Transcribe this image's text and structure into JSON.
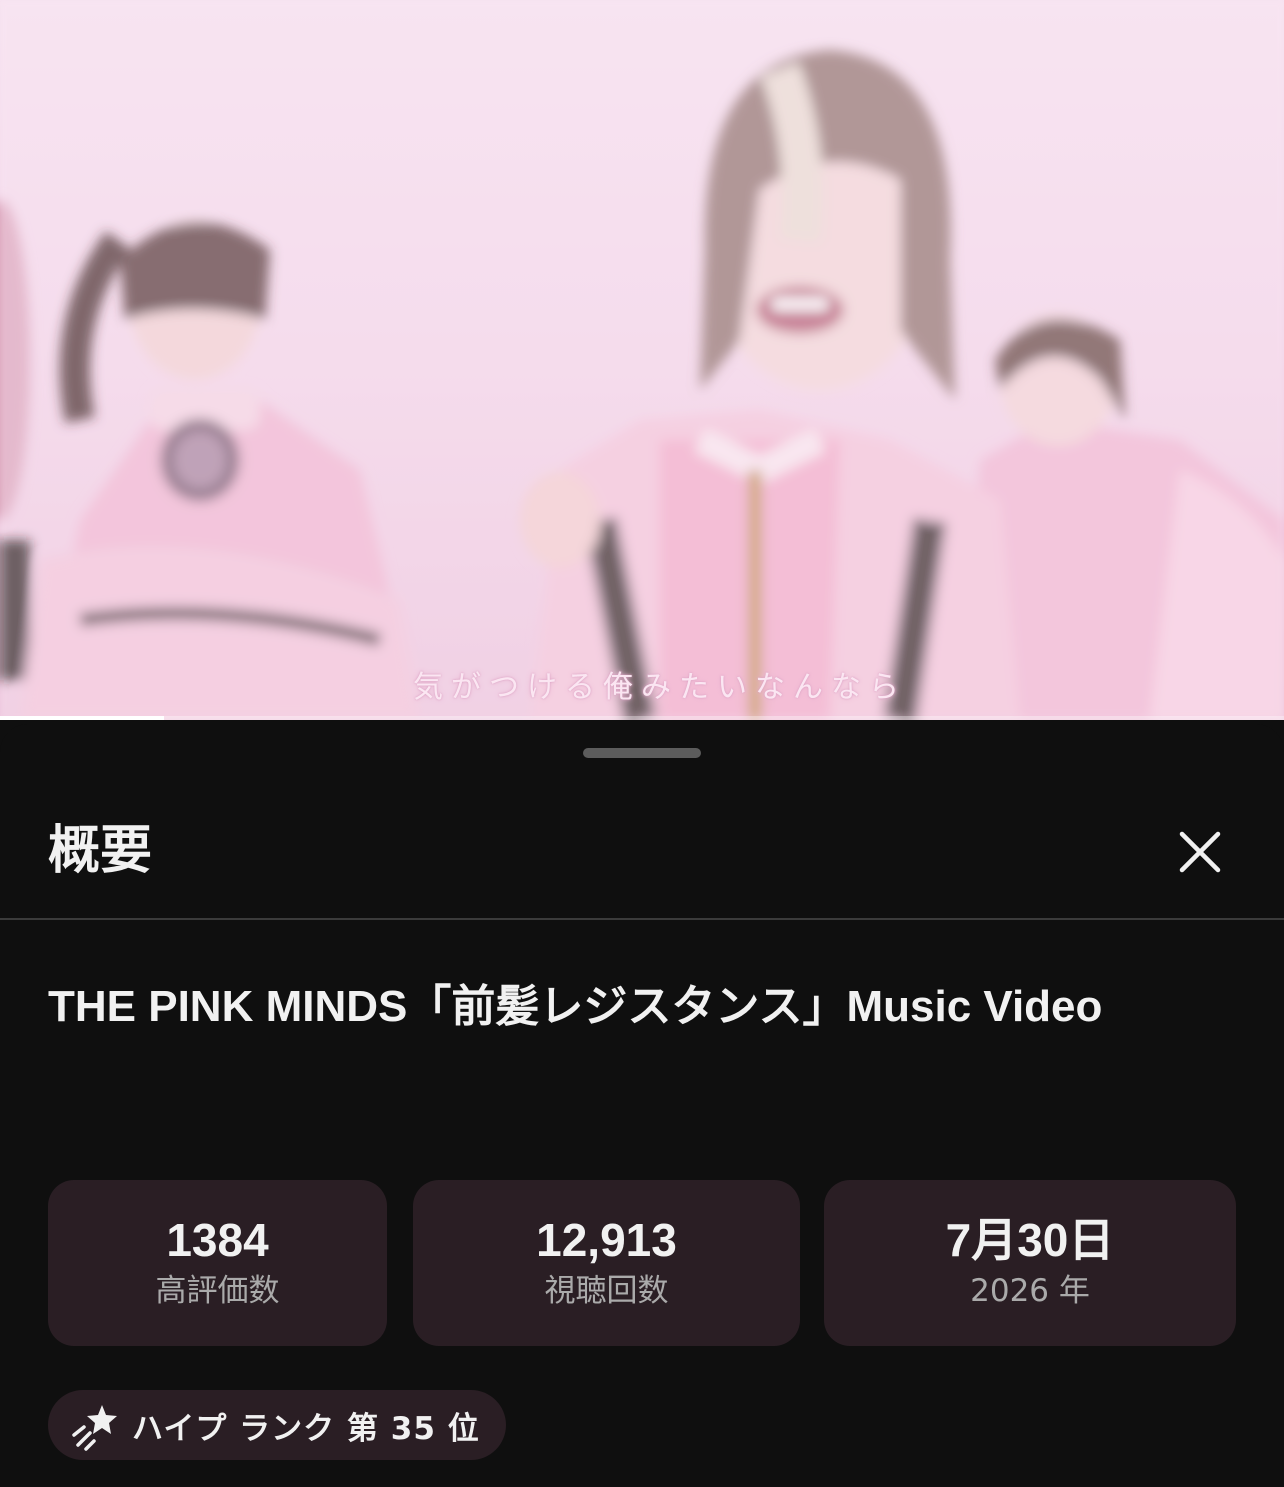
{
  "video": {
    "subtitle": "気がつける俺みたいなんなら",
    "progress": 0.128
  },
  "sheet": {
    "title": "概要",
    "close_icon": "close-icon"
  },
  "description": {
    "title": "THE PINK MINDS「前髪レジスタンス」Music Video",
    "stats": [
      {
        "value": "1384",
        "label": "高評価数"
      },
      {
        "value": "12,913",
        "label": "視聴回数"
      },
      {
        "value": "7月30日",
        "label": "2026 年"
      }
    ],
    "hype": {
      "icon": "hype-star-icon",
      "label": "ハイプ ランク 第 35 位"
    }
  },
  "colors": {
    "sheet_bg": "#0f0f0f",
    "card_bg": "#2a1e24",
    "text_primary": "#f1f1f1",
    "text_secondary": "#aaaaaa"
  }
}
